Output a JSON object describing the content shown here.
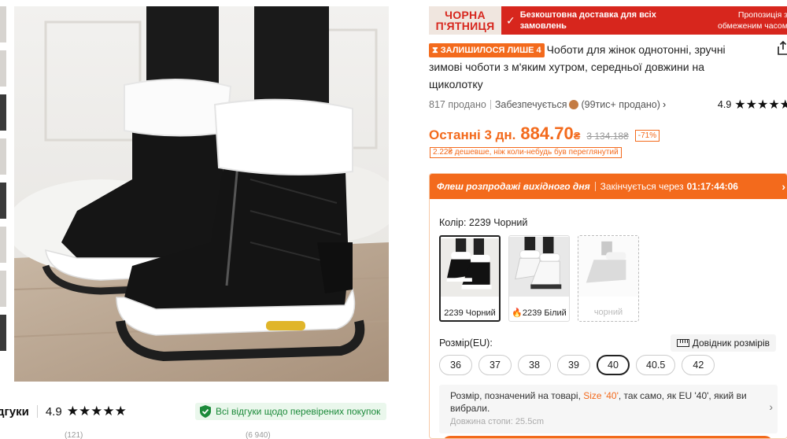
{
  "gallery": {
    "main_image_alt": "Black winter boots with white fur trim and zipper"
  },
  "reviews": {
    "title": "дгуки",
    "rating": "4.9",
    "stars": "★★★★★",
    "verified_text": "Всі відгуки щодо перевірених покупок",
    "below_left": "(121)",
    "below_right": "(6 940)"
  },
  "promo": {
    "badge_line1": "ЧОРНА",
    "badge_line2": "П'ЯТНИЦЯ",
    "check": "✓",
    "text": "Безкоштовна доставка для всіх замовлень",
    "right_text": "Пропозиція з обмеженим часом"
  },
  "product": {
    "hurry_badge": "ЗАЛИШИЛОСЯ ЛИШЕ 4",
    "title": "Чоботи для жінок однотонні, зручні зимові чоботи з м'яким хутром, середньої довжини на щиколотку"
  },
  "meta": {
    "sold": "817 продано",
    "backed": "Забезпечується",
    "store_sold": "(99тис+ продано)",
    "chevron": "›",
    "rating": "4.9",
    "stars": "★★★★★"
  },
  "price": {
    "label": "Останні 3 дн.",
    "value": "884.70",
    "currency": "₴",
    "old": "3 134.18₴",
    "discount": "-71%",
    "lowest_note": "2.22₴ дешевше, ніж коли-небудь був переглянутий"
  },
  "flash": {
    "title": "Флеш розпродажі вихідного дня",
    "ends_label": "Закінчується через",
    "time": "01:17:44:06",
    "arrow": "›"
  },
  "color": {
    "label": "Колір: 2239 Чорний",
    "options": [
      {
        "label": "2239 Чорний"
      },
      {
        "label": "2239 Білий",
        "flame": "🔥"
      },
      {
        "label": "чорний"
      }
    ]
  },
  "size": {
    "label": "Розмір(EU):",
    "guide": "Довідник розмірів",
    "options": [
      "36",
      "37",
      "38",
      "39",
      "40",
      "40.5",
      "42"
    ],
    "selected": "40",
    "note_prefix": "Розмір, позначений на товарі, ",
    "note_highlight": "Size '40'",
    "note_suffix": ", так само, як EU '40', який ви вибрали.",
    "note_faint": "Довжина стопи: 25.5cm",
    "note_chevron": "›"
  },
  "colors": {
    "accent": "#f36a1c",
    "promo_red": "#d7261d",
    "verified_green": "#1c8a3a"
  }
}
